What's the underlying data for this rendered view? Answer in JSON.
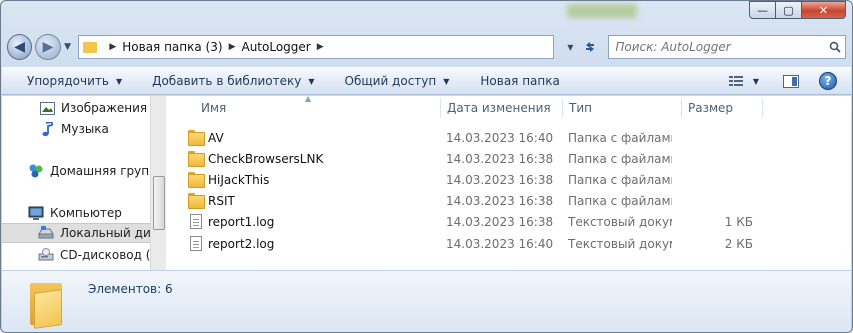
{
  "titlebar": {
    "minimize": "—",
    "maximize": "▢",
    "close": "✕"
  },
  "navigation": {
    "back": "◀",
    "forward": "▶",
    "breadcrumbs": [
      "Новая папка (3)",
      "AutoLogger"
    ],
    "search_placeholder": "Поиск: AutoLogger"
  },
  "toolbar": {
    "organize": "Упорядочить",
    "add_to_library": "Добавить в библиотеку",
    "share": "Общий доступ",
    "new_folder": "Новая папка"
  },
  "sidebar": {
    "items": [
      {
        "label": "Изображения",
        "icon": "pictures-icon"
      },
      {
        "label": "Музыка",
        "icon": "music-icon"
      },
      {
        "label": "Домашняя группа",
        "icon": "homegroup-icon"
      },
      {
        "label": "Компьютер",
        "icon": "computer-icon"
      },
      {
        "label": "Локальный диск",
        "icon": "hard-drive-icon"
      },
      {
        "label": "CD-дисковод (D:",
        "icon": "cd-drive-icon"
      }
    ]
  },
  "columns": {
    "name": "Имя",
    "date": "Дата изменения",
    "type": "Тип",
    "size": "Размер"
  },
  "files": [
    {
      "name": "AV",
      "date": "14.03.2023 16:40",
      "type": "Папка с файлами",
      "size": "",
      "kind": "folder"
    },
    {
      "name": "CheckBrowsersLNK",
      "date": "14.03.2023 16:38",
      "type": "Папка с файлами",
      "size": "",
      "kind": "folder"
    },
    {
      "name": "HiJackThis",
      "date": "14.03.2023 16:38",
      "type": "Папка с файлами",
      "size": "",
      "kind": "folder"
    },
    {
      "name": "RSIT",
      "date": "14.03.2023 16:38",
      "type": "Папка с файлами",
      "size": "",
      "kind": "folder"
    },
    {
      "name": "report1.log",
      "date": "14.03.2023 16:38",
      "type": "Текстовый докум...",
      "size": "1 КБ",
      "kind": "document"
    },
    {
      "name": "report2.log",
      "date": "14.03.2023 16:40",
      "type": "Текстовый докум...",
      "size": "2 КБ",
      "kind": "document"
    }
  ],
  "status": {
    "item_count": "Элементов: 6"
  },
  "colors": {
    "accent": "#1e395b",
    "folder": "#f4c54d",
    "titlebar": "#c9d9ec"
  }
}
